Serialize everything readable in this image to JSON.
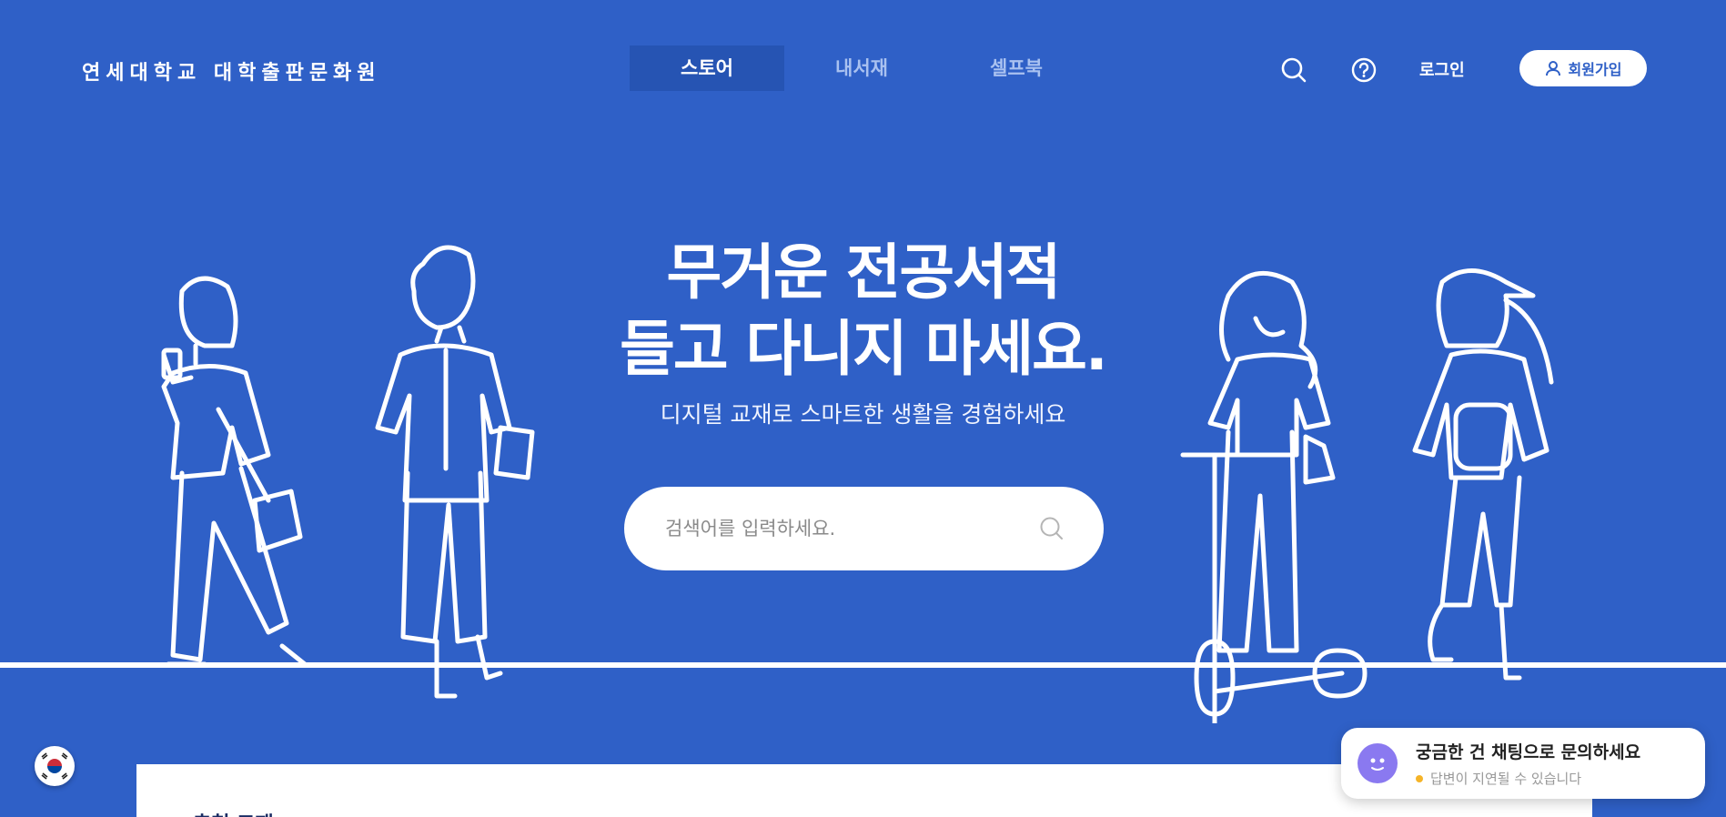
{
  "header": {
    "logo": "연세대학교 대학출판문화원",
    "tabs": [
      {
        "label": "스토어",
        "active": true
      },
      {
        "label": "내서재",
        "active": false
      },
      {
        "label": "셀프북",
        "active": false
      }
    ],
    "login_label": "로그인",
    "signup_label": "회원가입",
    "icons": [
      "search-icon",
      "help-icon",
      "user-icon"
    ]
  },
  "hero": {
    "title_line1": "무거운 전공서적",
    "title_line2": "들고 다니지 마세요.",
    "subtitle": "디지털 교재로 스마트한 생활을 경험하세요",
    "search_placeholder": "검색어를 입력하세요."
  },
  "chat": {
    "title": "궁금한 건 채팅으로 문의하세요",
    "status": "답변이 지연될 수 있습니다",
    "status_color": "#f5b428"
  },
  "content": {
    "section_title": "추천 교재"
  },
  "colors": {
    "background": "#2f60c7",
    "active_tab": "#2654b3",
    "bot": "#8a79f0"
  }
}
